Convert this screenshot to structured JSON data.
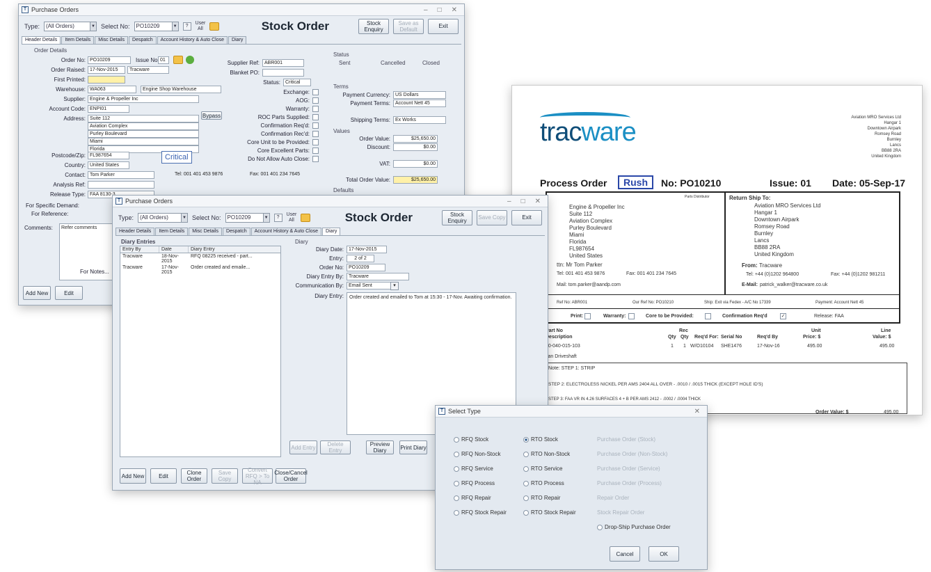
{
  "w1": {
    "title": "Purchase Orders",
    "type_label": "Type:",
    "type_value": "(All Orders)",
    "select_label": "Select No:",
    "select_value": "PO10209",
    "user_label": "User",
    "user_value": "All",
    "heading": "Stock Order",
    "btn_stock": "Stock Enquiry",
    "btn_save": "Save as Default",
    "btn_exit": "Exit",
    "tabs": [
      "Header Details",
      "Item Details",
      "Misc Details",
      "Despatch",
      "Account History & Auto Close",
      "Diary"
    ],
    "order_details": "Order Details",
    "order_no_label": "Order No:",
    "order_no": "PO10209",
    "issue_label": "Issue No:",
    "issue": "01",
    "order_raised_label": "Order Raised:",
    "order_raised_date": "17-Nov-2015",
    "order_raised_by": "Tracware",
    "first_raised_label": "First Printed:",
    "warehouse_label": "Warehouse:",
    "warehouse": "WA063",
    "warehouse_name": "Engine Shop Warehouse",
    "supplier_label": "Supplier:",
    "supplier": "Engine & Propeller Inc",
    "account_label": "Account Code:",
    "account": "ENPI01",
    "address_label": "Address:",
    "address": [
      "Suite 112",
      "Aviation Complex",
      "Purley Boulevard",
      "Miami",
      "Florida"
    ],
    "bypass_btn": "Bypass",
    "postcode_label": "Postcode/Zip:",
    "postcode": "FL987654",
    "country_label": "Country:",
    "country": "United States",
    "contact_label": "Contact:",
    "contact": "Tom Parker",
    "analysis_label": "Analysis Ref:",
    "release_label": "Release Type:",
    "release": "FAA 8130-3",
    "critical": "Critical",
    "tel": "Tel: 001 401 453 9876",
    "fax": "Fax: 001 401 234 7645",
    "supplier_ref_label": "Supplier Ref:",
    "supplier_ref": "ABR001",
    "blanket_label": "Blanket PO:",
    "status_label": "Status:",
    "status": "Critical",
    "exchange": "Exchange:",
    "aog": "AOG:",
    "warranty": "Warranty:",
    "roc": "ROC Parts Supplied:",
    "conf_req": "Confirmation Req'd:",
    "conf_rec": "Confirmation Rec'd:",
    "core": "Core Unit to be Provided:",
    "core_parts": "Core Excellent Parts:",
    "no_auto": "Do Not Allow Auto Close:",
    "status_box": "Status",
    "sent": "Sent",
    "cancelled": "Cancelled",
    "closed": "Closed",
    "terms_box": "Terms",
    "pay_currency_label": "Payment Currency:",
    "pay_currency": "US Dollars",
    "pay_terms_label": "Payment Terms:",
    "pay_terms": "Account Nett 45",
    "ship_terms_label": "Shipping Terms:",
    "ship_terms": "Ex Works",
    "values_box": "Values",
    "order_value_label": "Order Value:",
    "order_value": "$25,650.00",
    "discount_label": "Discount:",
    "discount": "$0.00",
    "vat_label": "VAT:",
    "vat": "$0.00",
    "total_label": "Total Order Value:",
    "total": "$25,650.00",
    "defaults": "Defaults",
    "specific_label": "For Specific Demand:",
    "ref_label": "For Reference:",
    "comments_label": "Comments:",
    "comments": "Refer comments",
    "for_notes": "For Notes...",
    "btn_add": "Add New",
    "btn_edit": "Edit"
  },
  "w2": {
    "title": "Purchase Orders",
    "type_label": "Type:",
    "type_value": "(All Orders)",
    "select_label": "Select No:",
    "select_value": "PO10209",
    "user_label": "User",
    "user_value": "All",
    "heading": "Stock Order",
    "btn_stock": "Stock Enquiry",
    "btn_save": "Save Copy",
    "btn_exit": "Exit",
    "tabs": [
      "Header Details",
      "Item Details",
      "Misc Details",
      "Despatch",
      "Account History & Auto Close",
      "Diary"
    ],
    "diary_entries": "Diary Entries",
    "cols": [
      "Entry By",
      "Date",
      "Diary Entry"
    ],
    "rows": [
      [
        "Tracware",
        "18-Nov-2015",
        "RFQ 08225 received - part..."
      ],
      [
        "Tracware",
        "17-Nov-2015",
        "Order created and emaile..."
      ]
    ],
    "diary_box": "Diary",
    "diary_date_label": "Diary Date:",
    "diary_date": "17-Nov-2015",
    "entry_label": "Entry:",
    "entry": "2 of 2",
    "order_no_label": "Order No:",
    "order_no": "PO10209",
    "entry_by_label": "Diary Entry By:",
    "entry_by": "Tracware",
    "comm_label": "Communication By:",
    "comm": "Email Sent",
    "diary_entry_label": "Diary Entry:",
    "diary_entry": "Order created and emailed to Tom at 15:30 - 17-Nov. Awaiting confirmation.",
    "btn_add_entry": "Add Entry",
    "btn_delete_entry": "Delete Entry",
    "btn_preview": "Preview Diary",
    "btn_print": "Print Diary",
    "btn_add": "Add New",
    "btn_edit": "Edit",
    "btn_clone": "Clone Order",
    "btn_convert": "Convert RFQ > To NA",
    "btn_close": "Close/Cancel Order"
  },
  "doc": {
    "logo_a": "trac",
    "logo_b": "ware",
    "company": [
      "Aviation MRO Services Ltd",
      "Hangar 1",
      "Downtown Airpark",
      "Romsey Road",
      "Burnley",
      "Lancs",
      "BB88 2RA",
      "United Kingdom"
    ],
    "title": "Process Order",
    "rush": "Rush",
    "no": "No: PO10210",
    "issue": "Issue: 01",
    "date": "Date: 05-Sep-17",
    "parts_dist": "Parts Distributor",
    "supplier_lines": [
      "Engine & Propeller Inc",
      "Suite 112",
      "Aviation Complex",
      "Purley Boulevard",
      "Miami",
      "Florida",
      "FL987654",
      "United States"
    ],
    "attn": "ttn: Mr Tom Parker",
    "tel": "Tel: 001 401 453 9876",
    "fax": "Fax: 001 401 234 7645",
    "email": "Mail: tom.parker@aandp.com",
    "return_label": "Return Ship To:",
    "return_lines": [
      "Aviation MRO Services Ltd",
      "Hangar 1",
      "Downtown Airpark",
      "Romsey Road",
      "Burnley",
      "Lancs",
      "BB88 2RA",
      "United Kingdom"
    ],
    "from_label": "From:",
    "from": "Tracware",
    "tel2": "Tel: +44 (0)1202 964800",
    "fax2": "Fax: +44 (0)1202 981211",
    "email2_label": "E-Mail:",
    "email2": "patrick_walker@tracware.co.uk",
    "ref_no": "Ref No: ABR001",
    "our_ref": "Our Ref No: PO10210",
    "ship": "Ship: Exit via Fedex - A/C No 17339",
    "payment": "Payment: Account Nett 45",
    "print": "Print:",
    "warranty": "Warranty:",
    "core": "Core to be Provided:",
    "conf": "Confirmation Req'd",
    "release": "Release: FAA",
    "col_part": "Part No",
    "col_desc": "Description",
    "col_rec": "Rec",
    "col_qty": "Qty",
    "col_qty2": "Qty",
    "col_reqd_for": "Req'd For:",
    "col_serial": "Serial No",
    "col_reqd_by": "Req'd By",
    "col_unit": "Unit",
    "col_price": "Price: $",
    "col_line": "Line",
    "col_value": "Value: $",
    "row_part": "00-040-015-103",
    "row_qty1": "1",
    "row_qty2": "1",
    "row_reqd_for": "W/O10104",
    "row_serial": "SHE1476",
    "row_reqd_by": "17-Nov-16",
    "row_price": "495.00",
    "row_value": "495.00",
    "row_desc": "tian Driveshaft",
    "note": "Note: STEP 1: STRIP",
    "step2": "STEP 2: ELECTROLESS NICKEL PER AMS 2404 ALL OVER - .0010 / .0015 THICK (EXCEPT HOLE ID'S)",
    "step3": "STEP 3: FAA VR IN 4.26 SURFACES 4 + B PER AMS 2412 - .0002 / .0004 THICK",
    "order_value_label": "Order Value: $",
    "order_value": "495.00"
  },
  "dlg": {
    "title": "Select Type",
    "col1": [
      "RFQ Stock",
      "RFQ Non-Stock",
      "RFQ Service",
      "RFQ Process",
      "RFQ Repair",
      "RFQ Stock Repair"
    ],
    "col2": [
      "RTO Stock",
      "RTO Non-Stock",
      "RTO Service",
      "RTO Process",
      "RTO Repair",
      "RTO Stock Repair"
    ],
    "col3": [
      "Purchase Order (Stock)",
      "Purchase Order (Non-Stock)",
      "Purchase Order (Service)",
      "Purchase Order (Process)",
      "Repair Order",
      "Stock Repair Order",
      "Drop-Ship Purchase Order"
    ],
    "cancel": "Cancel",
    "ok": "OK"
  }
}
